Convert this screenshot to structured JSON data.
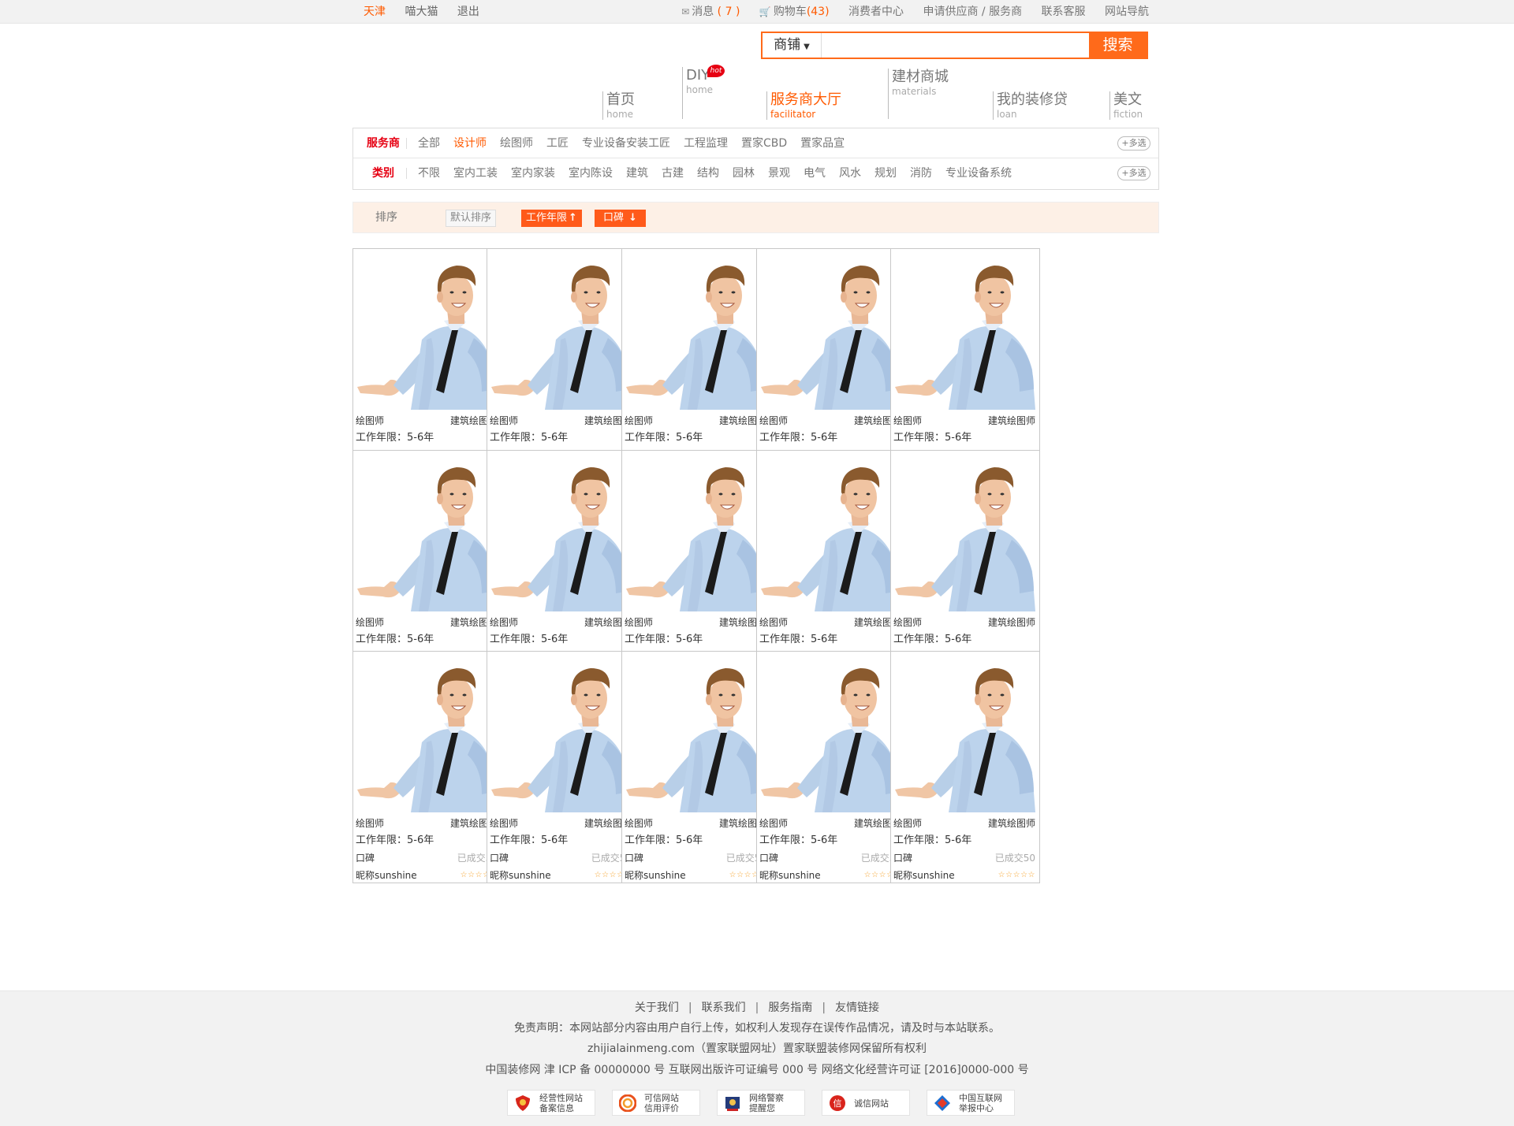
{
  "topbar": {
    "city": "天津",
    "user": "喵大猫",
    "logout": "退出",
    "messages_label": "消息",
    "messages_count": "( 7 )",
    "cart_label": "购物车",
    "cart_count": "(43)",
    "consumer_center": "消费者中心",
    "apply_supplier": "申请供应商 / 服务商",
    "contact_service": "联系客服",
    "site_nav": "网站导航"
  },
  "search": {
    "scope": "商铺",
    "placeholder": "",
    "button": "搜索"
  },
  "nav": [
    {
      "cn": "首页",
      "en": "home"
    },
    {
      "cn": "DIY",
      "en": "home",
      "badge": "hot"
    },
    {
      "cn": "服务商大厅",
      "en": "facilitator"
    },
    {
      "cn": "建材商城",
      "en": "materials"
    },
    {
      "cn": "我的装修贷",
      "en": "loan"
    },
    {
      "cn": "美文",
      "en": "fiction"
    }
  ],
  "filter": {
    "row1": {
      "label": "服务商",
      "options": [
        "全部",
        "设计师",
        "绘图师",
        "工匠",
        "专业设备安装工匠",
        "工程监理",
        "置家CBD",
        "置家品宣"
      ],
      "selected": "设计师",
      "more": "+多选"
    },
    "row2": {
      "label": "类别",
      "options": [
        "不限",
        "室内工装",
        "室内家装",
        "室内陈设",
        "建筑",
        "古建",
        "结构",
        "园林",
        "景观",
        "电气",
        "风水",
        "规划",
        "消防",
        "专业设备系统"
      ],
      "more": "+多选"
    }
  },
  "sort": {
    "label": "排序",
    "default": "默认排序",
    "years": "工作年限",
    "reputation": "口碑"
  },
  "card": {
    "role": "绘图师",
    "specialty": "建筑绘图师",
    "years": "工作年限：5-6年",
    "reputation": "口碑",
    "deals": "已成交50",
    "nickname": "昵称sunshine",
    "stars": "☆☆☆☆☆"
  },
  "footer": {
    "links": [
      "关于我们",
      "联系我们",
      "服务指南",
      "友情链接"
    ],
    "disclaimer": "免责声明：本网站部分内容由用户自行上传，如权利人发现存在误传作品情况，请及时与本站联系。",
    "copyright": "zhijialainmeng.com（置家联盟网址）置家联盟装修网保留所有权利",
    "license": "中国装修网 津 ICP 备 00000000 号   互联网出版许可证编号 000 号   网络文化经营许可证 [2016]0000-000 号",
    "badges": [
      {
        "line1": "经营性网站",
        "line2": "备案信息"
      },
      {
        "line1": "可信网站",
        "line2": "信用评价"
      },
      {
        "line1": "网络警察",
        "line2": "提醒您"
      },
      {
        "line1": "诚信网站",
        "line2": ""
      },
      {
        "line1": "中国互联网",
        "line2": "举报中心"
      }
    ]
  },
  "colors": {
    "accent": "#ff5a00",
    "label_red": "#e60012",
    "star": "#f7a531",
    "sort_bg": "#fdf0e6"
  }
}
